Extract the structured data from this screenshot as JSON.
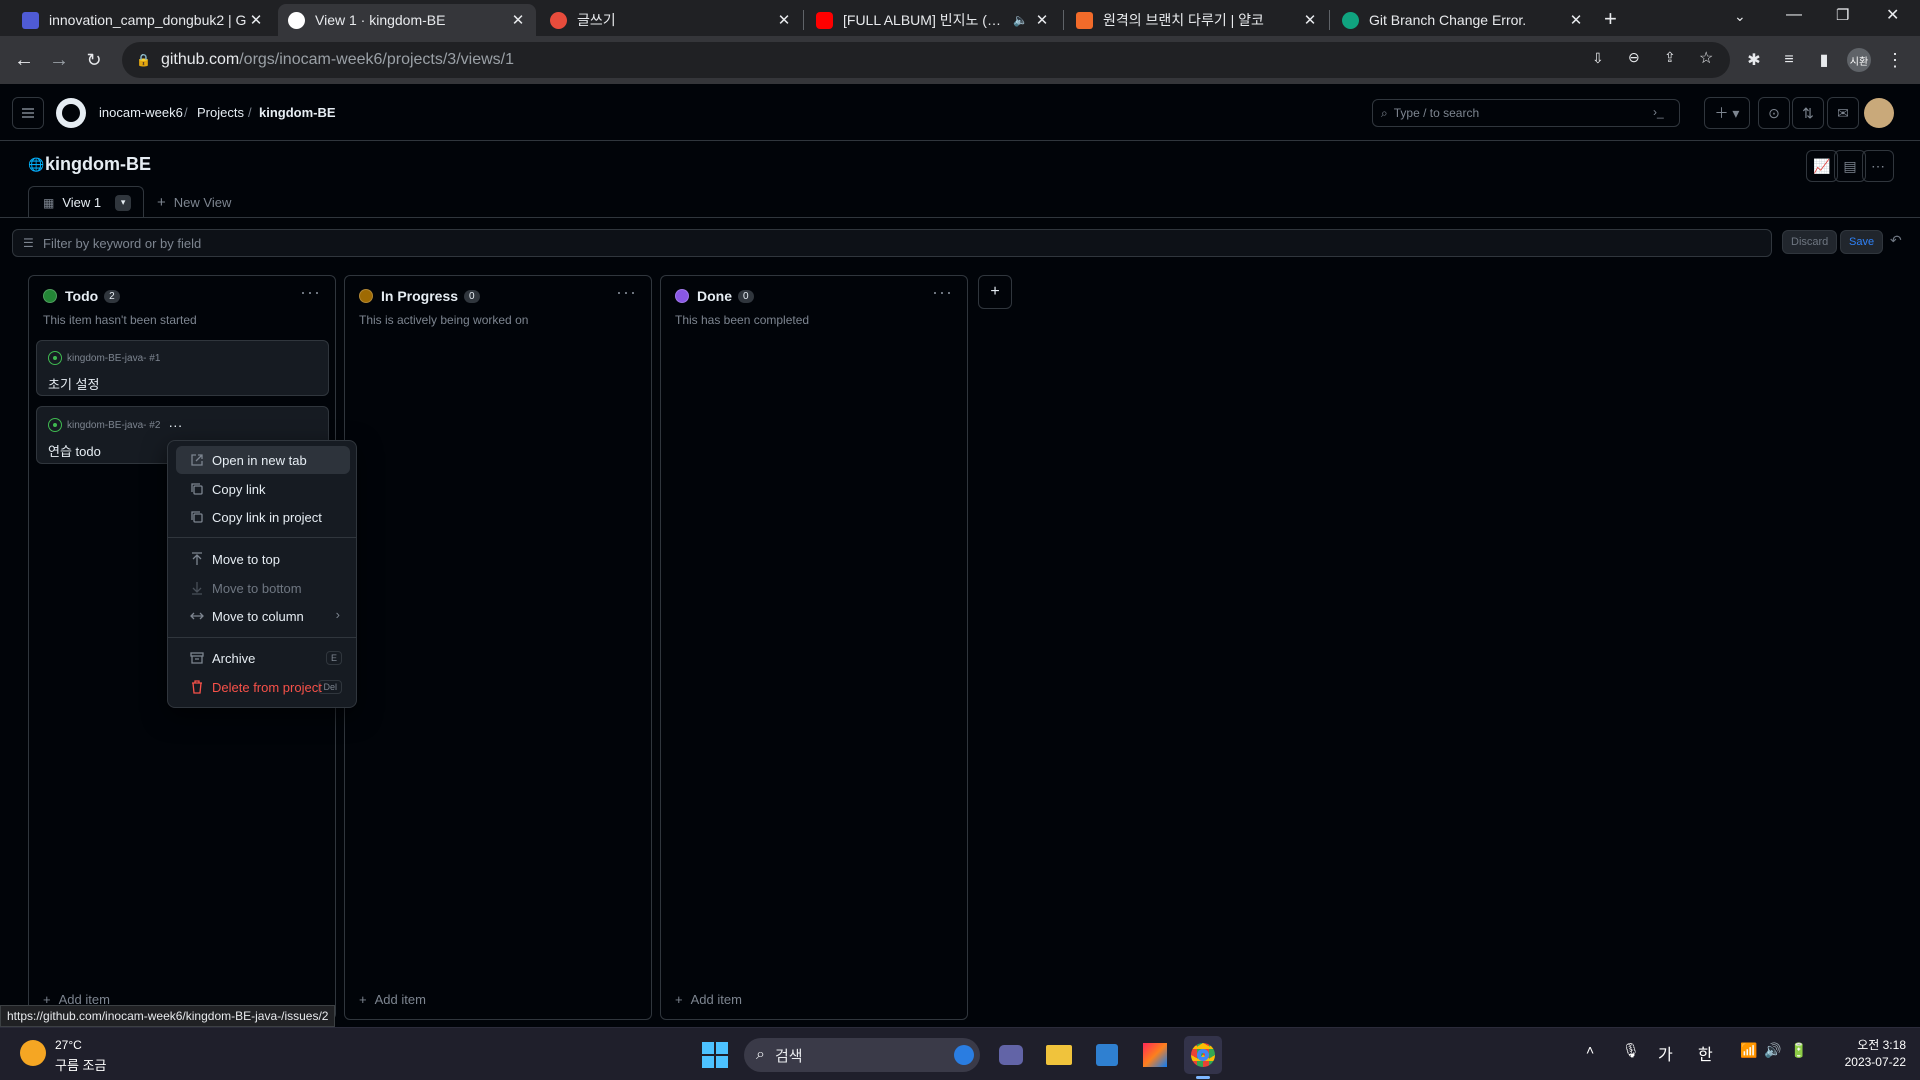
{
  "browser": {
    "tabs": [
      {
        "title": "innovation_camp_dongbuk2 | G",
        "favicon_color": "#4f5bd5"
      },
      {
        "title": "View 1 · kingdom-BE",
        "favicon_color": "#ffffff"
      },
      {
        "title": "글쓰기",
        "favicon_color": "#e74c3c"
      },
      {
        "title": "[FULL ALBUM] 빈지노 (Been",
        "favicon_color": "#ff0000"
      },
      {
        "title": "원격의 브랜치 다루기 | 얄코",
        "favicon_color": "#f26b2a"
      },
      {
        "title": "Git Branch Change Error.",
        "favicon_color": "#10a37f"
      }
    ],
    "url_host": "github.com",
    "url_path": "/orgs/inocam-week6/projects/3/views/1",
    "profile_label": "시환"
  },
  "github": {
    "breadcrumbs": [
      "inocam-week6",
      "Projects",
      "kingdom-BE"
    ],
    "search_placeholder": "Type / to search"
  },
  "project": {
    "title": "kingdom-BE",
    "views": [
      {
        "label": "View 1"
      }
    ],
    "new_view_label": "New View",
    "filter_placeholder": "Filter by keyword or by field",
    "discard_label": "Discard",
    "save_label": "Save"
  },
  "columns": [
    {
      "name": "Todo",
      "count": "2",
      "description": "This item hasn't been started",
      "color": "#238636",
      "add_label": "Add item",
      "cards": [
        {
          "ref": "kingdom-BE-java- #1",
          "title": "초기 설정"
        },
        {
          "ref": "kingdom-BE-java- #2",
          "title": "연습 todo"
        }
      ]
    },
    {
      "name": "In Progress",
      "count": "0",
      "description": "This is actively being worked on",
      "color": "#9e6a03",
      "add_label": "Add item",
      "cards": []
    },
    {
      "name": "Done",
      "count": "0",
      "description": "This has been completed",
      "color": "#8957e5",
      "add_label": "Add item",
      "cards": []
    }
  ],
  "context_menu": {
    "items": [
      {
        "label": "Open in new tab",
        "icon": "external-link-icon"
      },
      {
        "label": "Copy link",
        "icon": "copy-icon"
      },
      {
        "label": "Copy link in project",
        "icon": "copy-icon"
      },
      {
        "label": "Move to top",
        "icon": "arrow-up-icon"
      },
      {
        "label": "Move to bottom",
        "icon": "arrow-down-icon"
      },
      {
        "label": "Move to column",
        "icon": "arrow-both-icon"
      },
      {
        "label": "Archive",
        "icon": "archive-icon",
        "shortcut": "E"
      },
      {
        "label": "Delete from project",
        "icon": "trash-icon",
        "shortcut": "Del"
      }
    ]
  },
  "status_url": "https://github.com/inocam-week6/kingdom-BE-java-/issues/2",
  "taskbar": {
    "weather_temp": "27°C",
    "weather_desc": "구름 조금",
    "search_label": "검색",
    "ime_1": "가",
    "ime_2": "한",
    "time": "오전 3:18",
    "date": "2023-07-22"
  }
}
